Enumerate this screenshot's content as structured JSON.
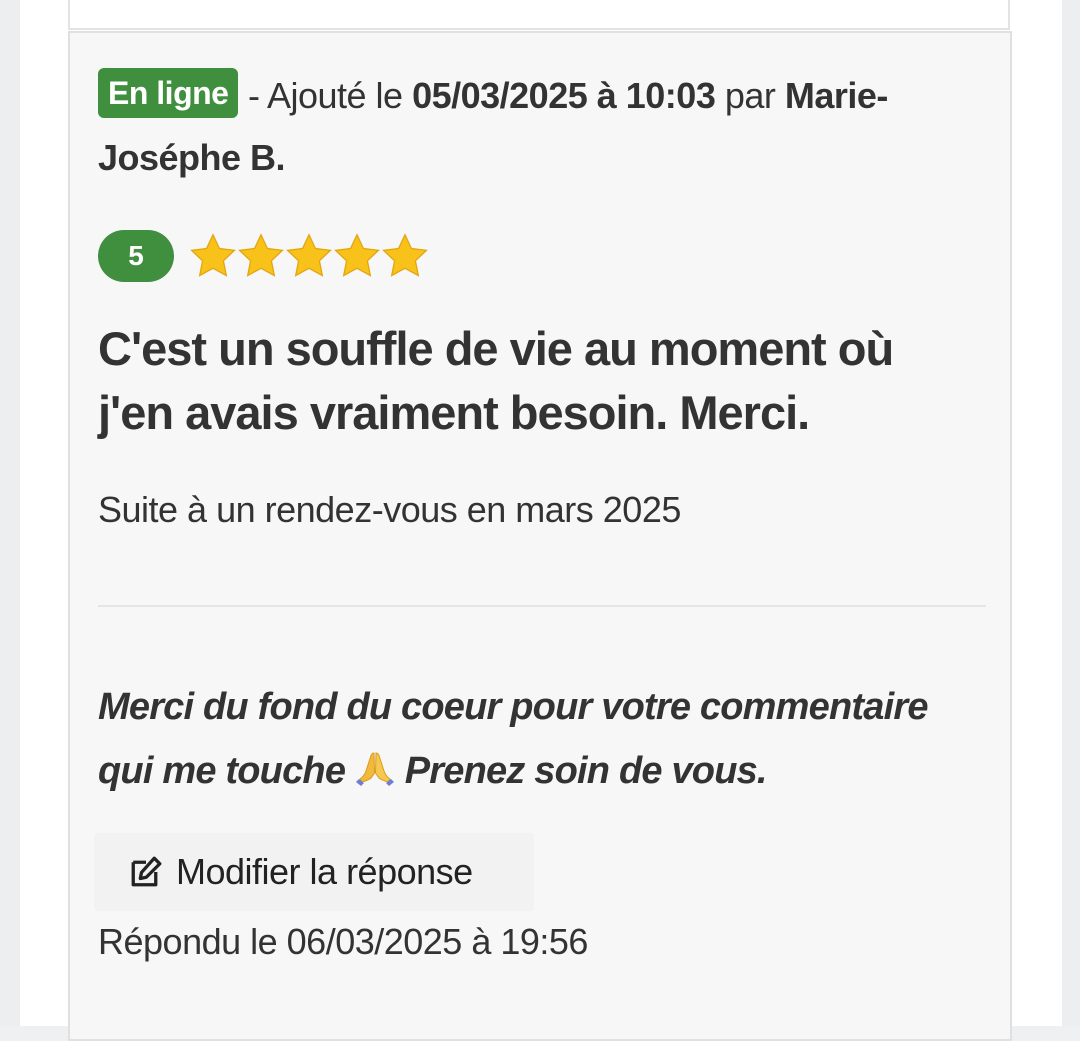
{
  "review": {
    "status_badge": "En ligne",
    "added_prefix": " - Ajouté le ",
    "added_datetime": "05/03/2025 à 10:03",
    "by_label": " par ",
    "author": "Marie-Joséphe B.",
    "rating_value": "5",
    "rating_stars": 5,
    "title": "C'est un souffle de vie au moment où j'en avais vraiment besoin. Merci.",
    "visit_context": "Suite à un rendez-vous en mars 2025"
  },
  "reply": {
    "text_before_emoji": "Merci du fond du coeur pour votre commentaire qui me touche ",
    "emoji": "folded-hands-emoji",
    "text_after_emoji": " Prenez soin de vous.",
    "edit_button_label": "Modifier la réponse",
    "edit_icon": "edit-icon",
    "replied_at": "Répondu le 06/03/2025 à 19:56"
  },
  "colors": {
    "badge_green": "#3f8f3f",
    "star_yellow": "#f8c21b",
    "card_background": "#f7f7f7",
    "text": "#333333"
  }
}
